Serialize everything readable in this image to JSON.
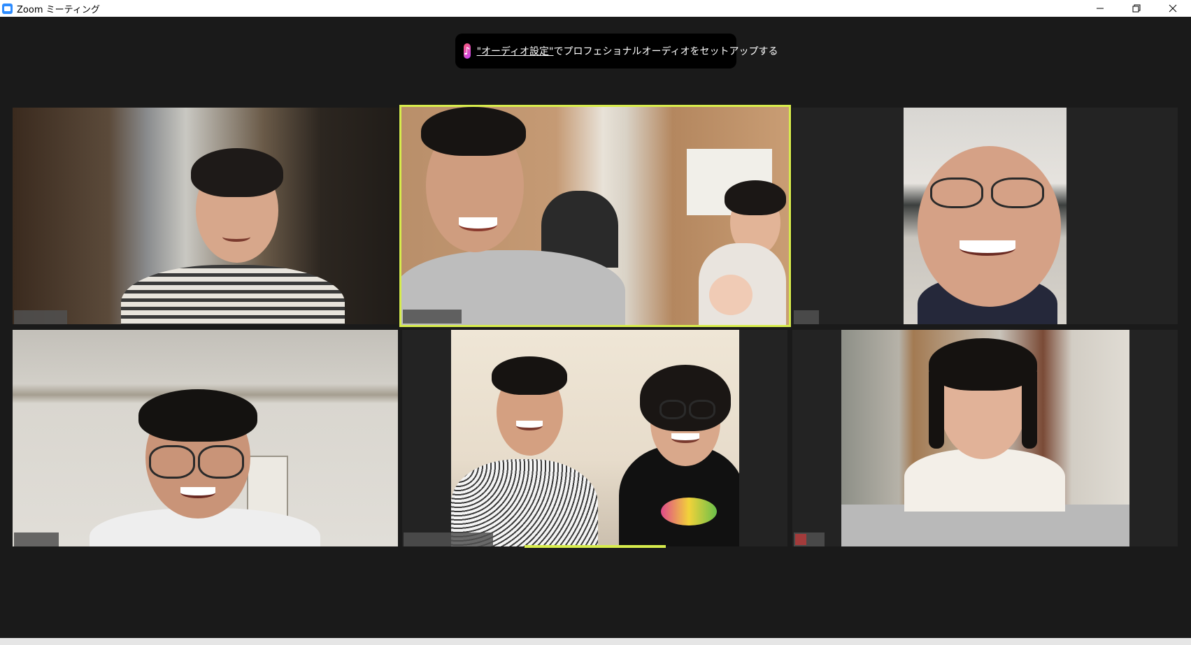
{
  "window": {
    "title": "Zoom ミーティング",
    "icon": "zoom-camera-icon"
  },
  "notice": {
    "icon": "music-note-icon",
    "link_text": "\"オーディオ設定\"",
    "message": "でプロフェショナルオーディオをセットアップする"
  },
  "participants": [
    {
      "tile": "top-left",
      "active": false
    },
    {
      "tile": "top-center",
      "active": true
    },
    {
      "tile": "top-right",
      "active": false
    },
    {
      "tile": "bottom-left",
      "active": false
    },
    {
      "tile": "bottom-center",
      "active": false
    },
    {
      "tile": "bottom-right",
      "active": false,
      "muted": true
    }
  ],
  "colors": {
    "active_speaker_border": "#d7ec4c",
    "background": "#1a1a1a",
    "tile_background": "#232323"
  }
}
